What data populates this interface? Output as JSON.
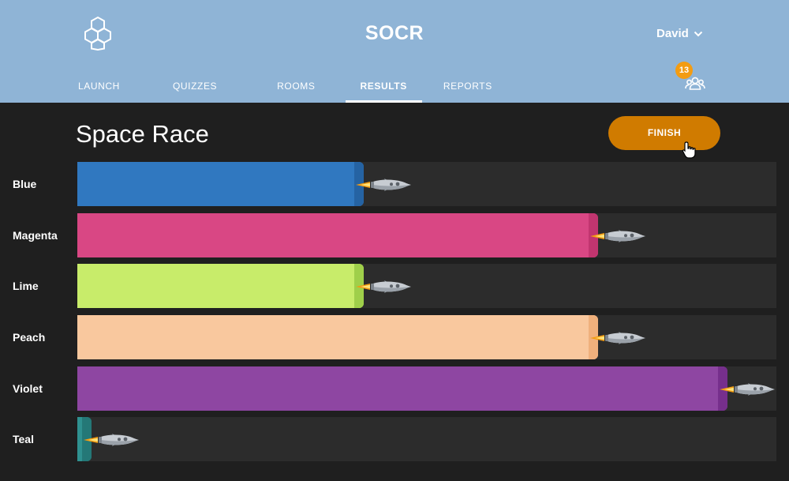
{
  "header": {
    "app_title": "SOCR",
    "user_name": "David",
    "logo_icon": "hexagon-cluster-icon",
    "notifications": {
      "count": "13",
      "icon": "people-icon"
    }
  },
  "nav": {
    "tabs": [
      {
        "label": "LAUNCH",
        "active": false
      },
      {
        "label": "QUIZZES",
        "active": false
      },
      {
        "label": "ROOMS",
        "active": false
      },
      {
        "label": "RESULTS",
        "active": true
      },
      {
        "label": "REPORTS",
        "active": false
      }
    ]
  },
  "main": {
    "title": "Space Race",
    "finish_label": "FINISH"
  },
  "race": {
    "teams": [
      {
        "name": "Blue",
        "progress": 0.41,
        "color": "#3078c0",
        "edge": "#2563a3"
      },
      {
        "name": "Magenta",
        "progress": 0.745,
        "color": "#d94784",
        "edge": "#c1356f"
      },
      {
        "name": "Lime",
        "progress": 0.41,
        "color": "#c8ec6a",
        "edge": "#9fcf4a"
      },
      {
        "name": "Peach",
        "progress": 0.745,
        "color": "#f9c89e",
        "edge": "#f0b07c"
      },
      {
        "name": "Violet",
        "progress": 0.93,
        "color": "#8e46a2",
        "edge": "#762f8c"
      },
      {
        "name": "Teal",
        "progress": 0.02,
        "color": "#2f9190",
        "edge": "#247877"
      }
    ]
  },
  "colors": {
    "header_bg": "#8fb4d6",
    "panel_bg": "#1f1f1f",
    "track_bg": "#2c2c2c",
    "finish_bg": "#d07b00",
    "badge_bg": "#f39c12"
  }
}
